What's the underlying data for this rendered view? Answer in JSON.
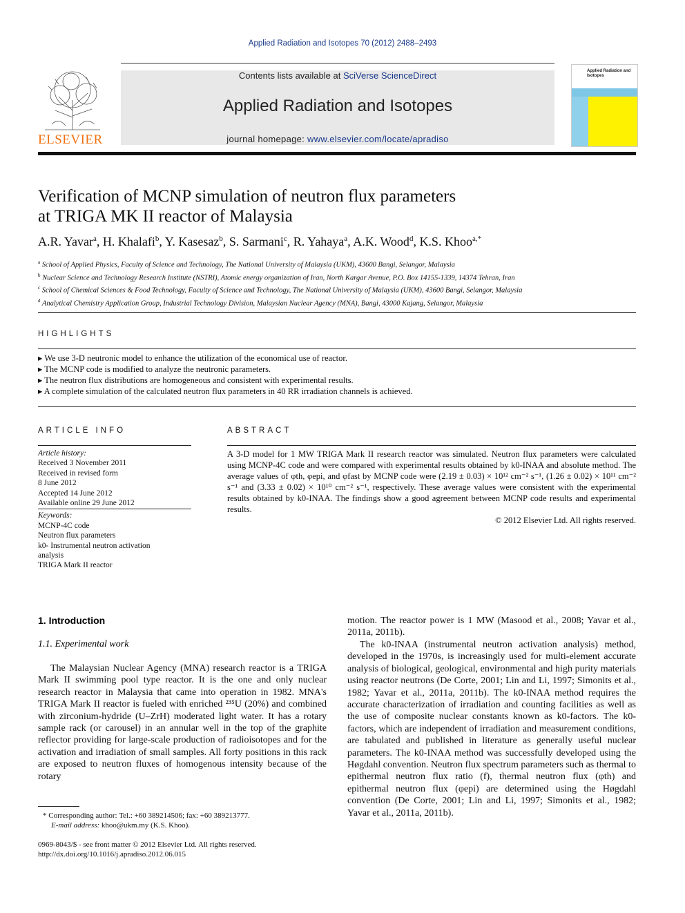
{
  "journal_ref": "Applied Radiation and Isotopes 70 (2012) 2488–2493",
  "header": {
    "contents_prefix": "Contents lists available at ",
    "contents_link": "SciVerse ScienceDirect",
    "journal_title": "Applied Radiation and Isotopes",
    "homepage_prefix": "journal homepage: ",
    "homepage_link": "www.elsevier.com/locate/apradiso",
    "publisher_logo": "ELSEVIER",
    "cover_title": "Applied Radiation and Isotopes"
  },
  "article": {
    "title_line1": "Verification of MCNP simulation of neutron flux parameters",
    "title_line2": "at TRIGA MK II reactor of Malaysia",
    "authors": [
      {
        "name": "A.R. Yavar",
        "aff": "a"
      },
      {
        "name": "H. Khalafi",
        "aff": "b"
      },
      {
        "name": "Y. Kasesaz",
        "aff": "b"
      },
      {
        "name": "S. Sarmani",
        "aff": "c"
      },
      {
        "name": "R. Yahaya",
        "aff": "a"
      },
      {
        "name": "A.K. Wood",
        "aff": "d"
      },
      {
        "name": "K.S. Khoo",
        "aff": "a,*"
      }
    ],
    "affiliations": [
      {
        "key": "a",
        "text": "School of Applied Physics, Faculty of Science and Technology, The National University of Malaysia (UKM), 43600 Bangi, Selangor, Malaysia"
      },
      {
        "key": "b",
        "text": "Nuclear Science and Technology Research Institute (NSTRI), Atomic energy organization of Iran, North Kargar Avenue, P.O. Box 14155-1339, 14374 Tehran, Iran"
      },
      {
        "key": "c",
        "text": "School of Chemical Sciences & Food Technology, Faculty of Science and Technology, The National University of Malaysia (UKM), 43600 Bangi, Selangor, Malaysia"
      },
      {
        "key": "d",
        "text": "Analytical Chemistry Application Group, Industrial Technology Division, Malaysian Nuclear Agency (MNA), Bangi, 43000 Kajang, Selangor, Malaysia"
      }
    ]
  },
  "highlights": {
    "label": "HIGHLIGHTS",
    "items": [
      "We use 3-D neutronic model to enhance the utilization of the economical use of reactor.",
      "The MCNP code is modified to analyze the neutronic parameters.",
      "The neutron flux distributions are homogeneous and consistent with experimental results.",
      "A complete simulation of the calculated neutron flux parameters in 40 RR irradiation channels is achieved."
    ]
  },
  "article_info": {
    "label": "ARTICLE INFO",
    "history_label": "Article history:",
    "history": [
      "Received 3 November 2011",
      "Received in revised form",
      "8 June 2012",
      "Accepted 14 June 2012",
      "Available online 29 June 2012"
    ],
    "keywords_label": "Keywords:",
    "keywords": [
      "MCNP-4C code",
      "Neutron flux parameters",
      "k0- Instrumental neutron activation",
      "analysis",
      "TRIGA Mark II reactor"
    ]
  },
  "abstract": {
    "label": "ABSTRACT",
    "text1": "A 3-D model for 1 MW TRIGA Mark II research reactor was simulated. Neutron flux parameters were calculated using MCNP-4C code and were compared with experimental results obtained by k0-INAA and absolute method. The average values of φth, φepi, and φfast by MCNP code were (2.19 ± 0.03) × 10¹² cm⁻² s⁻¹, (1.26 ± 0.02) × 10¹¹ cm⁻² s⁻¹ and (3.33 ± 0.02) × 10¹⁰ cm⁻² s⁻¹, respectively. These average values were consistent with the experimental results obtained by k0-INAA. The findings show a good agreement between MCNP code results and experimental results.",
    "copyright": "© 2012 Elsevier Ltd. All rights reserved."
  },
  "body": {
    "section1": "1.  Introduction",
    "subsection11": "1.1.  Experimental work",
    "left_para": "The Malaysian Nuclear Agency (MNA) research reactor is a TRIGA Mark II swimming pool type reactor. It is the one and only nuclear research reactor in Malaysia that came into operation in 1982. MNA's TRIGA Mark II reactor is fueled with enriched ²³⁵U (20%) and combined with zirconium-hydride (U–ZrH) moderated light water. It has a rotary sample rack (or carousel) in an annular well in the top of the graphite reflector providing for large-scale production of radioisotopes and for the activation and irradiation of small samples. All forty positions in this rack are exposed to neutron fluxes of homogenous intensity because of the rotary",
    "right_para1": "motion. The reactor power is 1 MW (Masood et al., 2008; Yavar et al., 2011a, 2011b).",
    "right_para2": "The k0-INAA (instrumental neutron activation analysis) method, developed in the 1970s, is increasingly used for multi-element accurate analysis of biological, geological, environmental and high purity materials using reactor neutrons (De Corte, 2001; Lin and Li, 1997; Simonits et al., 1982; Yavar et al., 2011a, 2011b). The k0-INAA method requires the accurate characterization of irradiation and counting facilities as well as the use of composite nuclear constants known as k0-factors. The k0-factors, which are independent of irradiation and measurement conditions, are tabulated and published in literature as generally useful nuclear parameters. The k0-INAA method was successfully developed using the Høgdahl convention. Neutron flux spectrum parameters such as thermal to epithermal neutron flux ratio (f), thermal neutron flux (φth) and epithermal neutron flux (φepi) are determined using the Høgdahl convention (De Corte, 2001; Lin and Li, 1997; Simonits et al., 1982; Yavar et al., 2011a, 2011b)."
  },
  "footnotes": {
    "corresponding": "* Corresponding author: Tel.: +60 389214506; fax: +60 389213777.",
    "email_label": "E-mail address: ",
    "email": "khoo@ukm.my",
    "email_suffix": " (K.S. Khoo).",
    "issn": "0969-8043/$ - see front matter © 2012 Elsevier Ltd. All rights reserved.",
    "doi": "http://dx.doi.org/10.1016/j.apradiso.2012.06.015"
  }
}
